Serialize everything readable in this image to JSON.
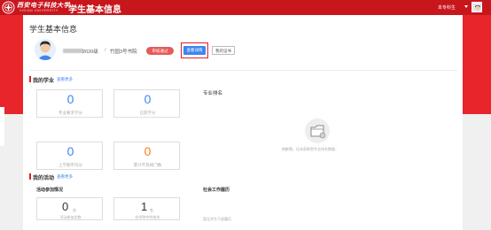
{
  "header": {
    "university_name": "西安电子科技大学",
    "university_en": "XIDIAN UNIVERSITY",
    "app_title": "学生基本信息",
    "user_role": "本专科生"
  },
  "profile": {
    "page_title": "学生基本信息",
    "grade": "2020级",
    "separator": "/",
    "college": "竹园3号书院",
    "status_badge": "审核通过",
    "detail_button": "查看详情",
    "cert_button": "我的证书"
  },
  "studies": {
    "title": "我的学业",
    "more_link": "查看更多",
    "stats": [
      {
        "value": "0",
        "label": "专业要求学分",
        "color": "#3c86f2"
      },
      {
        "value": "0",
        "label": "已获学分",
        "color": "#3c86f2"
      },
      {
        "value": "0",
        "label": "上学期平均分",
        "color": "#3c86f2"
      },
      {
        "value": "0",
        "label": "累计不及格门数",
        "color": "#f5821f"
      }
    ],
    "rank_title": "专业排名",
    "empty_text": "抱歉哦，还未获取到专业排名数据~"
  },
  "activities": {
    "title": "我的活动",
    "more_link": "查看更多",
    "participation_title": "活动参加情况",
    "items": [
      {
        "value": "0",
        "unit": "次",
        "label": "活动参加次数"
      },
      {
        "value": "1",
        "unit": "名",
        "label": "在学院中的排名"
      }
    ],
    "social_title": "社会工作履历",
    "social_empty": "暂无学生干部履历"
  }
}
